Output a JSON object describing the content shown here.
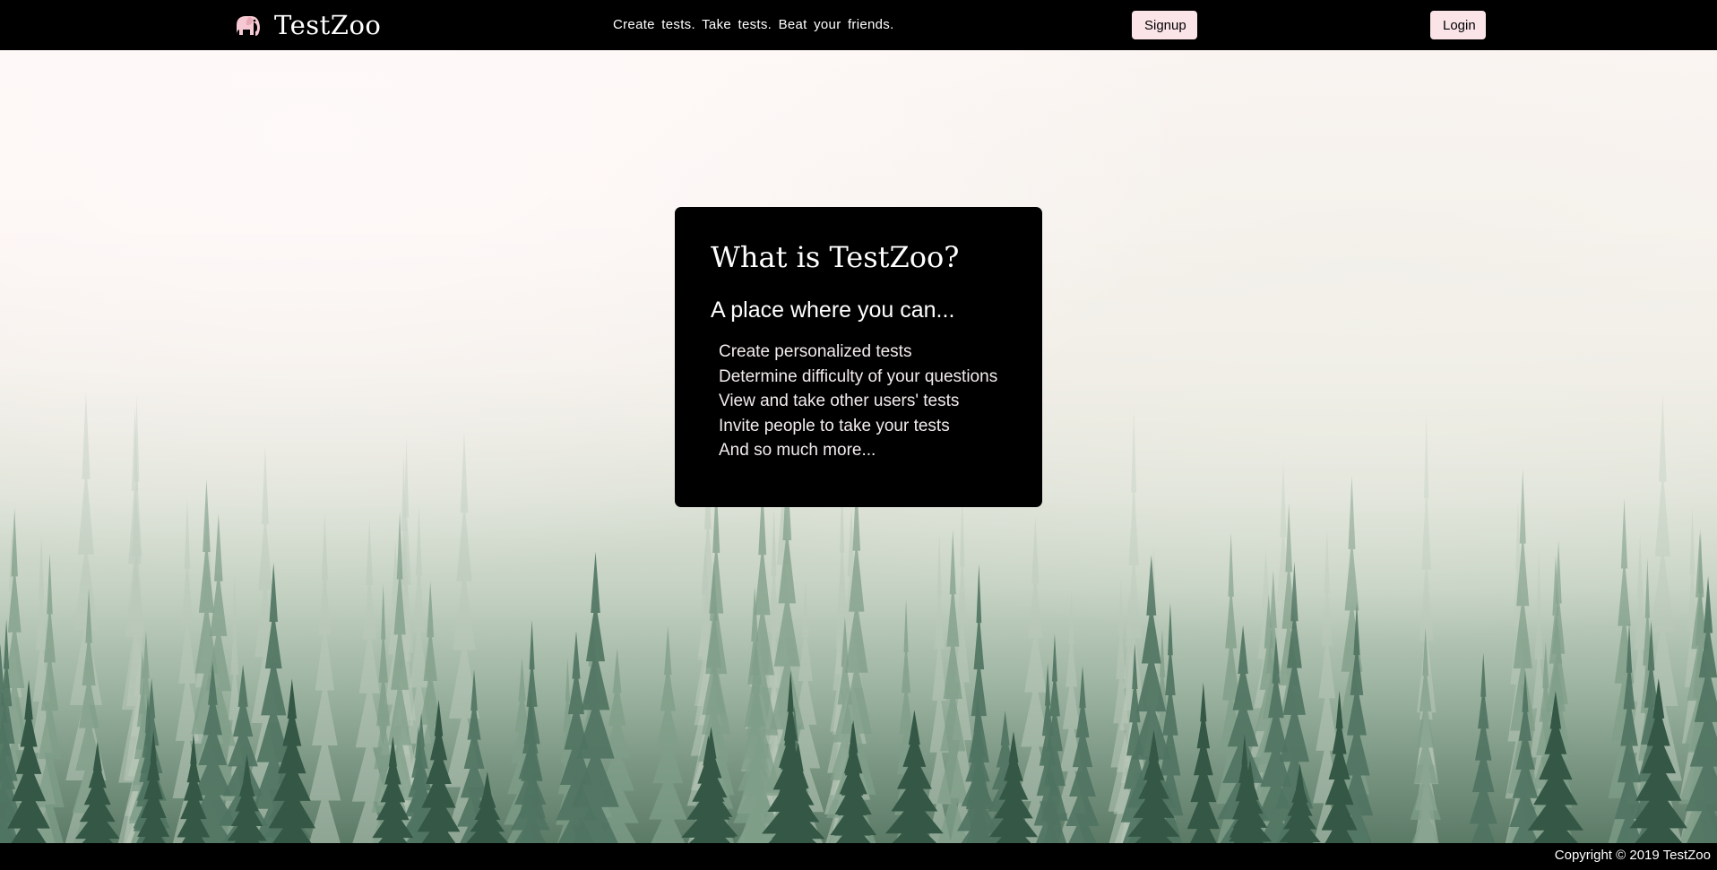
{
  "header": {
    "brand_name": "TestZoo",
    "logo_icon": "elephant-icon",
    "tagline": "Create tests. Take tests. Beat your friends.",
    "signup_label": "Signup",
    "login_label": "Login"
  },
  "hero": {
    "title": "What is TestZoo?",
    "subtitle": "A place where you can...",
    "features": [
      "Create personalized tests",
      "Determine difficulty of your questions",
      "View and take other users' tests",
      "Invite people to take your tests",
      "And so much more..."
    ]
  },
  "footer": {
    "copyright": "Copyright © 2019 TestZoo"
  },
  "colors": {
    "header_bg": "#000000",
    "button_bg": "#fbe4e8",
    "card_bg": "#000000"
  }
}
